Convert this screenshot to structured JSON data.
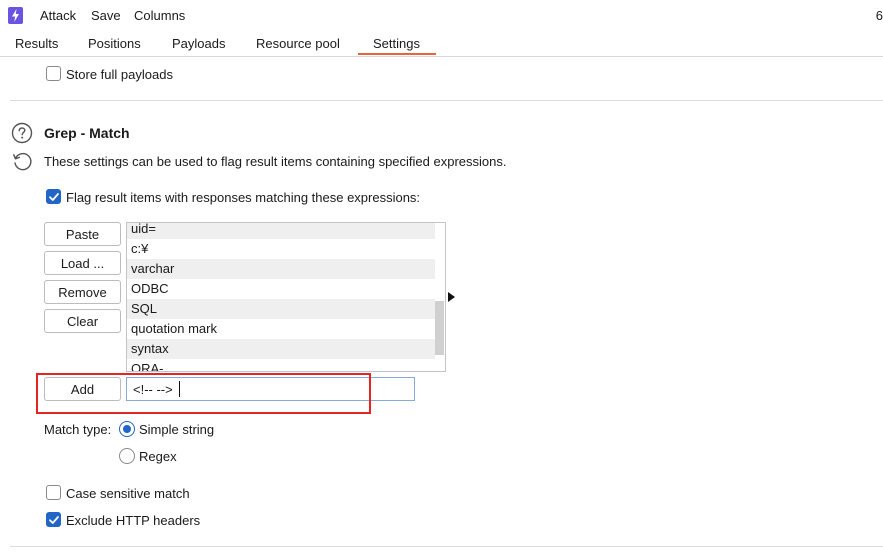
{
  "menubar": {
    "items": [
      "Attack",
      "Save",
      "Columns"
    ],
    "edge_text": "6"
  },
  "tabs": [
    "Results",
    "Positions",
    "Payloads",
    "Resource pool",
    "Settings"
  ],
  "active_tab": "Settings",
  "store_full_payloads": {
    "label": "Store full payloads",
    "checked": false
  },
  "grep_match": {
    "title": "Grep - Match",
    "description": "These settings can be used to flag result items containing specified expressions.",
    "flag_checkbox": {
      "label": "Flag result items with responses matching these expressions:",
      "checked": true
    },
    "buttons": {
      "paste": "Paste",
      "load": "Load ...",
      "remove": "Remove",
      "clear": "Clear",
      "add": "Add"
    },
    "expressions": [
      "uid=",
      "c:¥",
      "varchar",
      "ODBC",
      "SQL",
      "quotation mark",
      "syntax",
      "ORA-"
    ],
    "add_input_value": "<!-- -->",
    "match_type": {
      "label": "Match type:",
      "options": [
        "Simple string",
        "Regex"
      ],
      "selected": "Simple string"
    },
    "case_sensitive": {
      "label": "Case sensitive match",
      "checked": false
    },
    "exclude_http_headers": {
      "label": "Exclude HTTP headers",
      "checked": true
    }
  },
  "colors": {
    "accent": "#2166c7",
    "tab_underline": "#e8643b",
    "highlight": "#e52424",
    "app_icon": "#6a55e0"
  }
}
